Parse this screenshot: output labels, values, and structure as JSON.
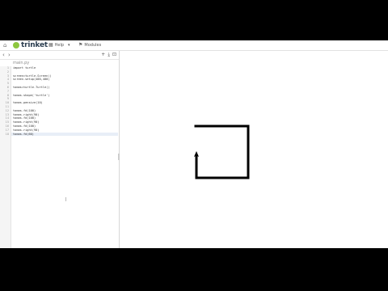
{
  "topbar": {
    "home_icon": "home-icon",
    "brand": "trinket",
    "help_label": "Help",
    "modules_label": "Modules",
    "menu_caret": "▾"
  },
  "editor": {
    "nav_arrows": "‹ ›",
    "file_name": "main.py",
    "tool_icons": [
      "+",
      "⤓",
      "⊡"
    ],
    "lines": [
      {
        "n": "1",
        "text": "import turtle"
      },
      {
        "n": "2",
        "text": ""
      },
      {
        "n": "3",
        "text": "screen=turtle.Screen()"
      },
      {
        "n": "4",
        "text": "screen.setup(400,400)"
      },
      {
        "n": "5",
        "text": ""
      },
      {
        "n": "6",
        "text": "tomas=turtle.Turtle()"
      },
      {
        "n": "7",
        "text": ""
      },
      {
        "n": "8",
        "text": "tomas.shape('turtle')"
      },
      {
        "n": "9",
        "text": ""
      },
      {
        "n": "10",
        "text": "tomas.pensize(10)"
      },
      {
        "n": "11",
        "text": ""
      },
      {
        "n": "12",
        "text": "tomas.fd(100)"
      },
      {
        "n": "13",
        "text": "tomas.right(90)"
      },
      {
        "n": "14",
        "text": "tomas.fd(100)"
      },
      {
        "n": "15",
        "text": "tomas.right(90)"
      },
      {
        "n": "16",
        "text": "tomas.fd(100)"
      },
      {
        "n": "17",
        "text": "tomas.right(90)"
      },
      {
        "n": "18",
        "text": "tomas.fd(60)"
      }
    ]
  },
  "canvas": {
    "pen_color": "#000000",
    "background": "#ffffff"
  }
}
